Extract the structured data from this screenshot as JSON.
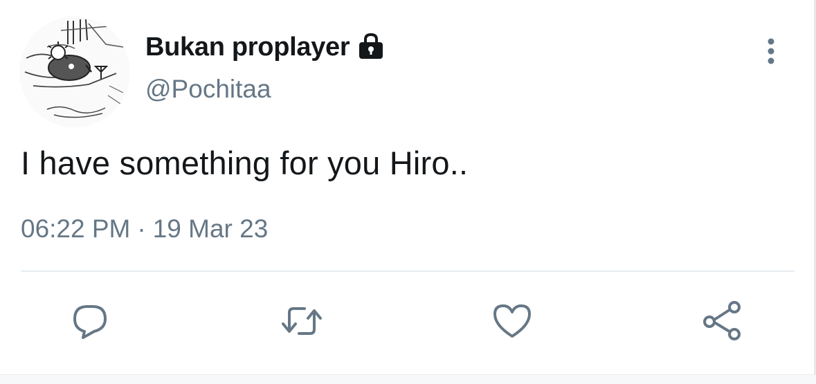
{
  "user": {
    "display_name": "Bukan proplayer",
    "handle": "@Pochitaa",
    "protected_icon": "lock-icon",
    "avatar": "cartoon-dog-avatar"
  },
  "tweet": {
    "text": "I have something for you Hiro..",
    "time": "06:22 PM",
    "separator": "·",
    "date": "19 Mar 23"
  },
  "actions": [
    {
      "name": "reply",
      "icon": "reply-icon"
    },
    {
      "name": "retweet",
      "icon": "retweet-icon"
    },
    {
      "name": "like",
      "icon": "heart-icon"
    },
    {
      "name": "share",
      "icon": "share-icon"
    }
  ],
  "menu": {
    "icon": "more-vertical-icon"
  },
  "colors": {
    "text_primary": "#14171a",
    "text_secondary": "#657786",
    "divider": "#e6ecf0"
  }
}
